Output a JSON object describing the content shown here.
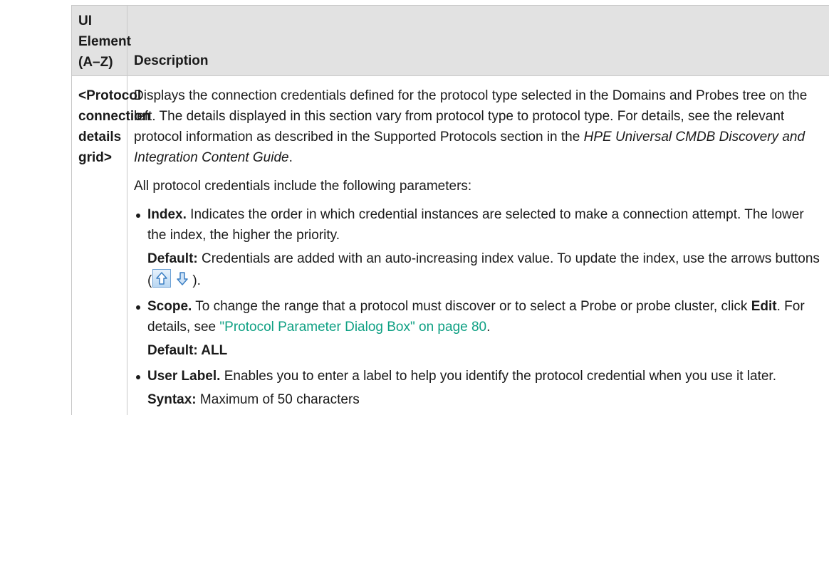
{
  "table": {
    "col1_header": "UI Element (A–Z)",
    "col2_header": "Description",
    "row": {
      "name": "<Protocol connection details grid>",
      "intro_before_italic": "Displays the connection credentials defined for the protocol type selected in the Domains and Probes tree on the left. The details displayed in this section vary from protocol type to protocol type. For details, see the relevant protocol information as described in the Supported Protocols section in the ",
      "intro_italic": "HPE Universal CMDB Discovery and Integration Content Guide",
      "intro_after_italic": ".",
      "params_intro": "All protocol credentials include the following parameters:",
      "index_label": "Index.",
      "index_text": " Indicates the order in which credential instances are selected to make a connection attempt. The lower the index, the higher the priority.",
      "index_default_label": "Default:",
      "index_default_text": " Credentials are added with an auto-increasing index value. To update the index, use the arrows buttons (",
      "index_default_after": ").",
      "scope_label": "Scope.",
      "scope_text": " To change the range that a protocol must discover or to select a Probe or probe cluster, click ",
      "scope_edit": "Edit",
      "scope_text2": ". For details, see ",
      "scope_link": "\"Protocol Parameter Dialog Box\" on page 80",
      "scope_after": ".",
      "scope_default": "Default: ALL",
      "user_label_label": "User Label.",
      "user_label_text": " Enables you to enter a label to help you identify the protocol credential when you use it later.",
      "syntax_label": "Syntax:",
      "syntax_text": " Maximum of 50 characters"
    }
  },
  "icons": [
    "arrow-up-icon",
    "arrow-down-icon"
  ],
  "colors": {
    "header_bg": "#e2e2e2",
    "border": "#c8c8c8",
    "link": "#0ea083"
  }
}
